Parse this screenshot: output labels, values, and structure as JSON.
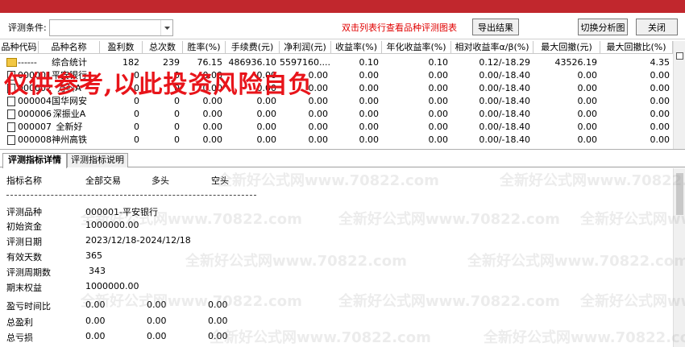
{
  "toolbar": {
    "condition_label": "评测条件:",
    "condition_value": "",
    "hint": "双击列表行查看品种评测图表",
    "export_label": "导出结果",
    "switch_label": "切换分析图",
    "close_label": "关闭"
  },
  "grid": {
    "headers": [
      "品种代码",
      "品种名称",
      "盈利数",
      "总次数",
      "胜率(%)",
      "手续费(元)",
      "净利润(元)",
      "收益率(%)",
      "年化收益率(%)",
      "相对收益率α/β(%)",
      "最大回撤(元)",
      "最大回撤比(%)"
    ],
    "summary": [
      "------",
      "综合统计",
      "182",
      "239",
      "76.15",
      "486936.10",
      "5597160....",
      "0.10",
      "0.10",
      "0.12/-18.29",
      "43526.19",
      "4.35"
    ],
    "rows": [
      [
        "000001",
        "平安银行",
        "0",
        "0",
        "0.00",
        "0.00",
        "0.00",
        "0.00",
        "0.00",
        "0.00/-18.40",
        "0.00",
        "0.00"
      ],
      [
        "000002",
        "万科A",
        "0",
        "0",
        "0.00",
        "0.00",
        "0.00",
        "0.00",
        "0.00",
        "0.00/-18.40",
        "0.00",
        "0.00"
      ],
      [
        "000004",
        "国华网安",
        "0",
        "0",
        "0.00",
        "0.00",
        "0.00",
        "0.00",
        "0.00",
        "0.00/-18.40",
        "0.00",
        "0.00"
      ],
      [
        "000006",
        "深振业A",
        "0",
        "0",
        "0.00",
        "0.00",
        "0.00",
        "0.00",
        "0.00",
        "0.00/-18.40",
        "0.00",
        "0.00"
      ],
      [
        "000007",
        "全新好",
        "0",
        "0",
        "0.00",
        "0.00",
        "0.00",
        "0.00",
        "0.00",
        "0.00/-18.40",
        "0.00",
        "0.00"
      ],
      [
        "000008",
        "神州高铁",
        "0",
        "0",
        "0.00",
        "0.00",
        "0.00",
        "0.00",
        "0.00",
        "0.00/-18.40",
        "0.00",
        "0.00"
      ]
    ]
  },
  "tabs": [
    "评测指标详情",
    "评测指标说明"
  ],
  "detail": {
    "header": [
      "指标名称",
      "全部交易",
      "多头",
      "空头"
    ],
    "info": [
      {
        "label": "评测品种",
        "value": "000001-平安银行"
      },
      {
        "label": "初始资金",
        "value": "1000000.00"
      },
      {
        "label": "评测日期",
        "value": "2023/12/18-2024/12/18"
      },
      {
        "label": "有效天数",
        "value": "365"
      },
      {
        "label": "评测周期数",
        "value": "343"
      },
      {
        "label": "期末权益",
        "value": "1000000.00"
      }
    ],
    "metrics": [
      {
        "label": "盈亏时间比",
        "all": "0.00",
        "long": "0.00",
        "short": "0.00"
      },
      {
        "label": "总盈利",
        "all": "0.00",
        "long": "0.00",
        "short": "0.00"
      },
      {
        "label": "总亏损",
        "all": "0.00",
        "long": "0.00",
        "short": "0.00"
      }
    ]
  },
  "overlay_text": "仅供参考,以此投资风险自负",
  "watermark": "全新好公式网www.70822.com",
  "colors": {
    "title_bar": "#c1272d",
    "hint": "#e00000",
    "overlay": "#e8141a"
  }
}
